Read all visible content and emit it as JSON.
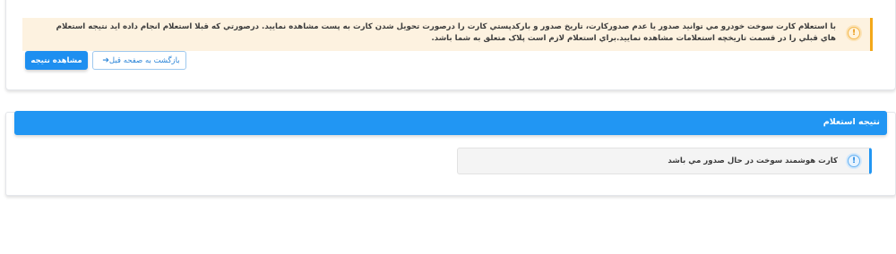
{
  "notice": {
    "text": "با استعلام کارت سوخت خودرو مي توانيد صدور يا عدم صدورکارت، تاريخ صدور و بارکدپستي کارت را درصورت تحويل شدن کارت به پست مشاهده نماييد. درصورتي که قبلا استعلام انجام داده ايد نتيجه استعلام هاي قبلي را در قسمت تاريخچه استعلامات مشاهده نماييد.براي استعلام لازم است پلاک متعلق به شما باشد.",
    "icon": "exclamation-icon",
    "accent_color": "#f3a81a"
  },
  "buttons": {
    "back_label": "بازگشت به صفحه قبل",
    "back_icon": "arrow-right-icon",
    "view_result_label": "مشاهده نتیجه"
  },
  "result": {
    "header_title": "نتیجه استعلام",
    "header_color": "#2196f3",
    "message": "کارت هوشمند سوخت در حال صدور مي باشد",
    "message_icon": "exclamation-icon"
  }
}
